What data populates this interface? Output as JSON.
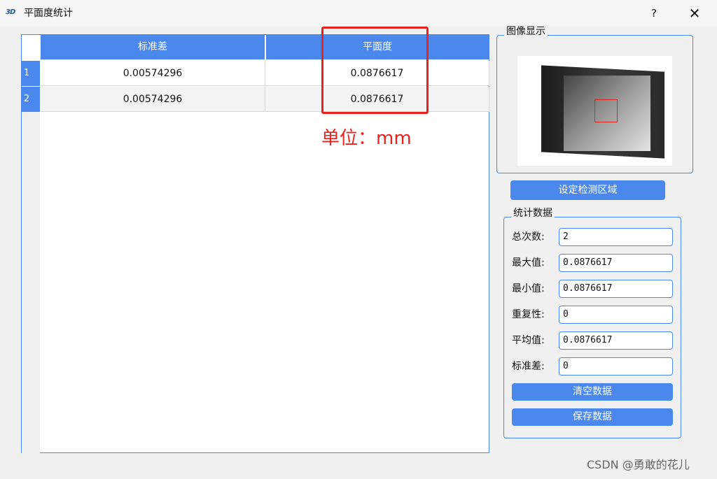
{
  "window": {
    "icon_text": "3D",
    "title": "平面度统计",
    "help_label": "?",
    "close_label": "✕"
  },
  "table": {
    "headers": [
      "标准差",
      "平面度"
    ],
    "rows": [
      {
        "index": "1",
        "values": [
          "0.00574296",
          "0.0876617"
        ]
      },
      {
        "index": "2",
        "values": [
          "0.00574296",
          "0.0876617"
        ]
      }
    ]
  },
  "annotation": {
    "text": "单位：mm",
    "color": "#e8231f"
  },
  "image_panel": {
    "title": "图像显示",
    "set_region_button": "设定检测区域"
  },
  "stats": {
    "title": "统计数据",
    "fields": [
      {
        "label": "总次数:",
        "value": "2"
      },
      {
        "label": "最大值:",
        "value": "0.0876617"
      },
      {
        "label": "最小值:",
        "value": "0.0876617"
      },
      {
        "label": "重复性:",
        "value": "0"
      },
      {
        "label": "平均值:",
        "value": "0.0876617"
      },
      {
        "label": "标准差:",
        "value": "0"
      }
    ],
    "clear_button": "清空数据",
    "save_button": "保存数据"
  },
  "watermark": "CSDN @勇敢的花儿",
  "colors": {
    "accent": "#4a88ee",
    "annotation": "#e8231f",
    "background": "#f0f0f0"
  }
}
